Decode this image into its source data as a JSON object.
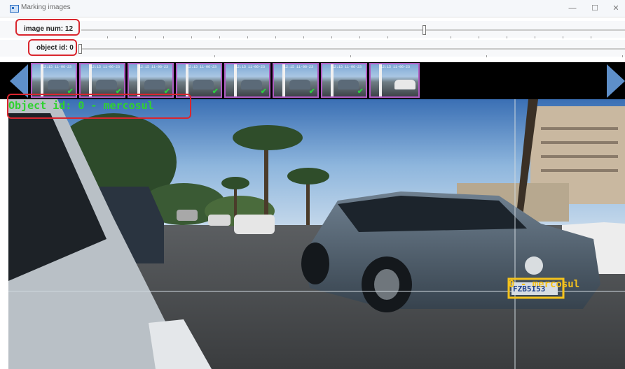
{
  "window": {
    "title": "Marking images",
    "controls": {
      "minimize": "—",
      "maximize": "☐",
      "close": "✕"
    }
  },
  "trackbars": {
    "image_num": {
      "label": "image num: 12",
      "value": 12
    },
    "object_id": {
      "label": "object id: 0",
      "value": 0
    }
  },
  "thumbnails": {
    "count": 8,
    "timestamp_text": "12:15 11-06-23"
  },
  "overlay": {
    "object_label": "Object id: 0  -  mercosul",
    "plate_label": "0 - mercosul",
    "plate_text": "FZB5I53",
    "colors": {
      "label": "#2fd22f",
      "plate_label": "#f4c21c",
      "highlight": "#d9262e",
      "nav": "#5e8fc9",
      "thumb_border": "#b05cc2"
    }
  },
  "icons": {
    "prev": "triangle-left-icon",
    "next": "triangle-right-icon",
    "check": "check-icon"
  }
}
